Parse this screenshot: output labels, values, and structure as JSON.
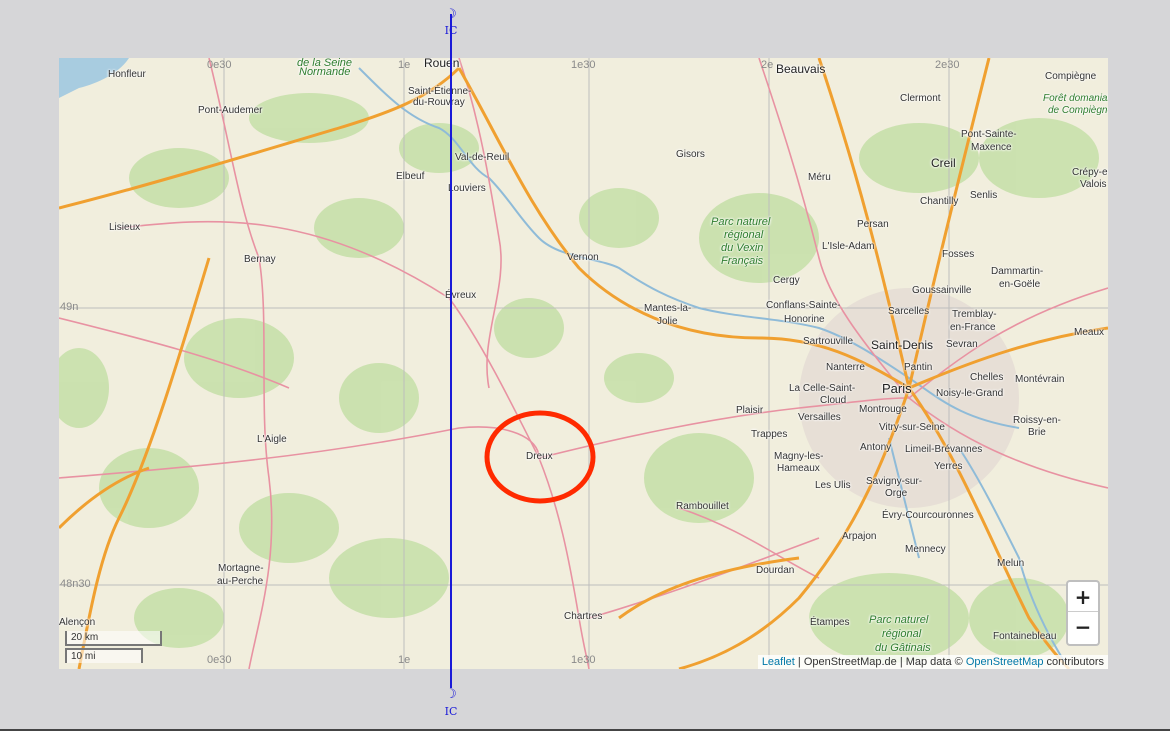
{
  "meridian_symbol": "☽",
  "meridian_label": "IC",
  "grid_labels": {
    "lon_0e30_top": "0e30",
    "lon_1e_top": "1e",
    "lon_1e30_top": "1e30",
    "lon_2e_top": "2e",
    "lon_2e30_top": "2e30",
    "lat_49n": "49n",
    "lat_48n30": "48n30",
    "lon_0e30_bottom": "0e30",
    "lon_1e_bottom": "1e",
    "lon_1e30_bottom": "1e30"
  },
  "places": {
    "honfleur": "Honfleur",
    "seine_normande_a": "de la Seine",
    "seine_normande_b": "Normande",
    "rouen": "Rouen",
    "st_etienne_a": "Saint-Étienne-",
    "st_etienne_b": "du-Rouvray",
    "beauvais": "Beauvais",
    "compiegne": "Compiègne",
    "foret_a": "Forêt domaniale",
    "foret_b": "de Compiègne",
    "pont_audemer": "Pont-Audemer",
    "clermont": "Clermont",
    "pont_ste_maxence_a": "Pont-Sainte-",
    "pont_ste_maxence_b": "Maxence",
    "elbeuf": "Elbeuf",
    "val_de_reuil": "Val-de-Reuil",
    "gisors": "Gisors",
    "creil": "Creil",
    "crepy_a": "Crépy-en-",
    "crepy_b": "Valois",
    "louviers": "Louviers",
    "meru": "Méru",
    "senlis": "Senlis",
    "chantilly": "Chantilly",
    "lisieux": "Lisieux",
    "vexin_a": "Parc naturel",
    "vexin_b": "régional",
    "vexin_c": "du Vexin",
    "vexin_d": "Français",
    "persan": "Persan",
    "lisle_adam": "L'Isle-Adam",
    "bernay": "Bernay",
    "vernon": "Vernon",
    "fosses": "Fosses",
    "dammartin_a": "Dammartin-",
    "dammartin_b": "en-Goële",
    "cergy": "Cergy",
    "goussainville": "Goussainville",
    "evreux": "Évreux",
    "conflans_a": "Conflans-Sainte-",
    "conflans_b": "Honorine",
    "mantes_a": "Mantes-la-",
    "mantes_b": "Jolie",
    "sarcelles": "Sarcelles",
    "tremblay_a": "Tremblay-",
    "tremblay_b": "en-France",
    "meaux": "Meaux",
    "sartrouville": "Sartrouville",
    "saint_denis": "Saint-Denis",
    "sevran": "Sevran",
    "nanterre": "Nanterre",
    "pantin": "Pantin",
    "chelles": "Chelles",
    "montevrain": "Montévrain",
    "paris": "Paris",
    "celle_a": "La Celle-Saint-",
    "celle_b": "Cloud",
    "noisy": "Noisy-le-Grand",
    "plaisir": "Plaisir",
    "montrouge": "Montrouge",
    "versailles": "Versailles",
    "roissy_a": "Roissy-en-",
    "roissy_b": "Brie",
    "laigle": "L'Aigle",
    "trappes": "Trappes",
    "vitry": "Vitry-sur-Seine",
    "antony": "Antony",
    "limeil": "Limeil-Brévannes",
    "dreux": "Dreux",
    "magny_a": "Magny-les-",
    "magny_b": "Hameaux",
    "yerres": "Yerres",
    "les_ulis": "Les Ulis",
    "savigny_a": "Savigny-sur-",
    "savigny_b": "Orge",
    "rambouillet": "Rambouillet",
    "evry": "Évry-Courcouronnes",
    "arpajon": "Arpajon",
    "mennecy": "Mennecy",
    "mortagne_a": "Mortagne-",
    "mortagne_b": "au-Perche",
    "dourdan": "Dourdan",
    "melun": "Melun",
    "alencon": "Alençon",
    "chartres": "Chartres",
    "etampes": "Étampes",
    "gatinais_a": "Parc naturel",
    "gatinais_b": "régional",
    "gatinais_c": "du Gâtinais",
    "fontainebleau": "Fontainebleau"
  },
  "zoom": {
    "in_label": "+",
    "out_label": "−"
  },
  "scale": {
    "km": "20 km",
    "mi": "10 mi"
  },
  "attribution": {
    "leaflet": "Leaflet",
    "sep1": " | OpenStreetMap.de | Map data © ",
    "osm": "OpenStreetMap",
    "suffix": " contributors"
  },
  "colors": {
    "meridian": "#1a1ad8",
    "marker_circle": "#ff2a00",
    "motorway": "#f0a030",
    "primary_road": "#e892a2",
    "forest": "#c5dfa8",
    "water": "#a8cce0"
  }
}
